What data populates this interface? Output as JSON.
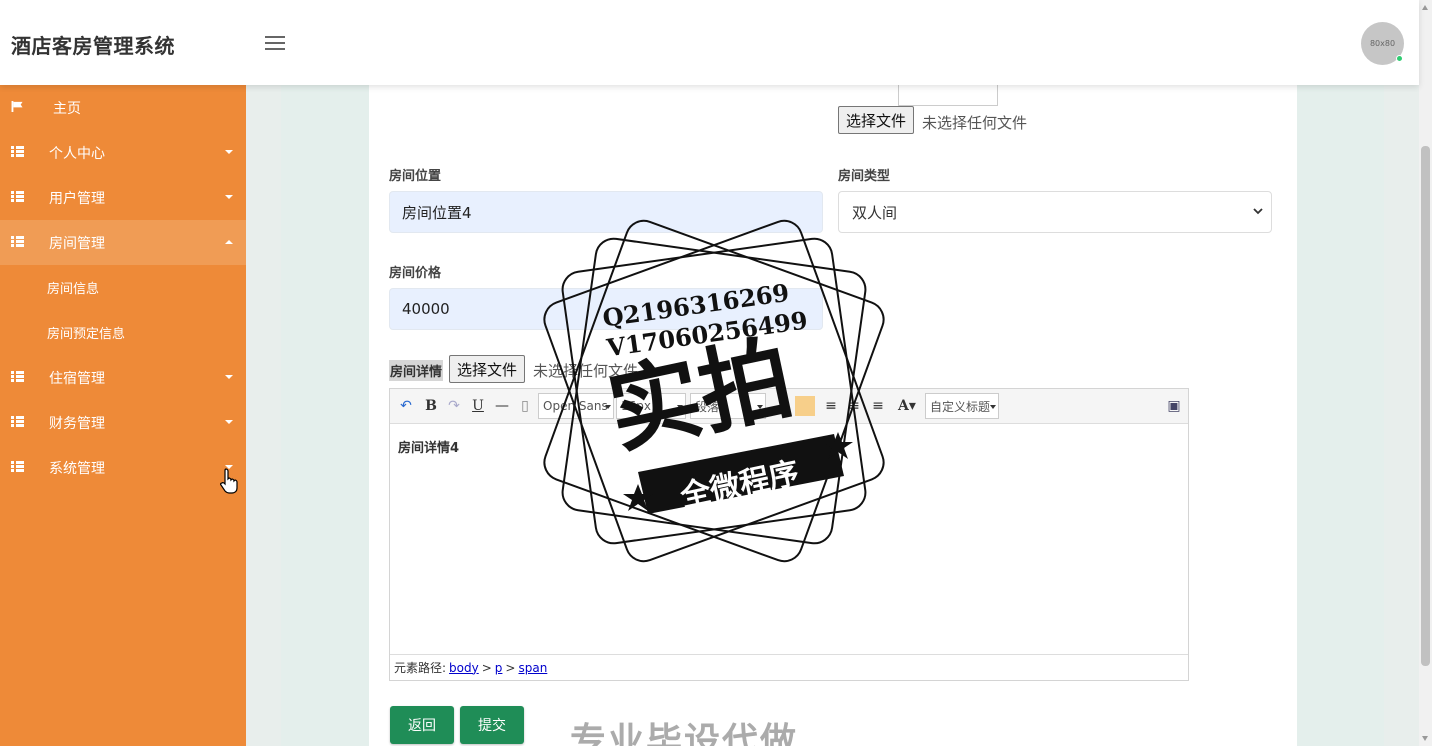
{
  "app": {
    "title": "酒店客房管理系统",
    "avatar_text": "80x80"
  },
  "sidebar": {
    "items": [
      {
        "label": "主页",
        "icon": "flag-icon"
      },
      {
        "label": "个人中心",
        "icon": "grid-icon"
      },
      {
        "label": "用户管理",
        "icon": "grid-icon"
      },
      {
        "label": "房间管理",
        "icon": "grid-icon",
        "expanded": true
      },
      {
        "label": "住宿管理",
        "icon": "grid-icon"
      },
      {
        "label": "财务管理",
        "icon": "grid-icon"
      },
      {
        "label": "系统管理",
        "icon": "grid-icon"
      }
    ],
    "subitems": [
      {
        "label": "房间信息"
      },
      {
        "label": "房间预定信息"
      }
    ]
  },
  "form": {
    "image_upload": {
      "button": "选择文件",
      "status": "未选择任何文件"
    },
    "location": {
      "label": "房间位置",
      "value": "房间位置4"
    },
    "type": {
      "label": "房间类型",
      "value": "双人间"
    },
    "price": {
      "label": "房间价格",
      "value": "40000"
    },
    "detail": {
      "label": "房间详情",
      "file_button": "选择文件",
      "file_status": "未选择任何文件",
      "content": "房间详情4"
    },
    "editor": {
      "font_family": "Open Sans",
      "font_size": "16px",
      "paragraph": "段落",
      "custom_title": "自定义标题",
      "path_label": "元素路径:",
      "path": [
        "body",
        "p",
        "span"
      ]
    },
    "buttons": {
      "back": "返回",
      "submit": "提交"
    }
  },
  "watermark": {
    "line1": "Q2196316269",
    "line2": "V17060256499",
    "main": "实拍",
    "sub": "全微程序",
    "bottom": "专业毕设代做"
  },
  "colors": {
    "sidebar": "#ee8a38",
    "sidebar_active": "#f09c55",
    "button": "#1f8d57",
    "input_bg": "#e8f0fe"
  }
}
